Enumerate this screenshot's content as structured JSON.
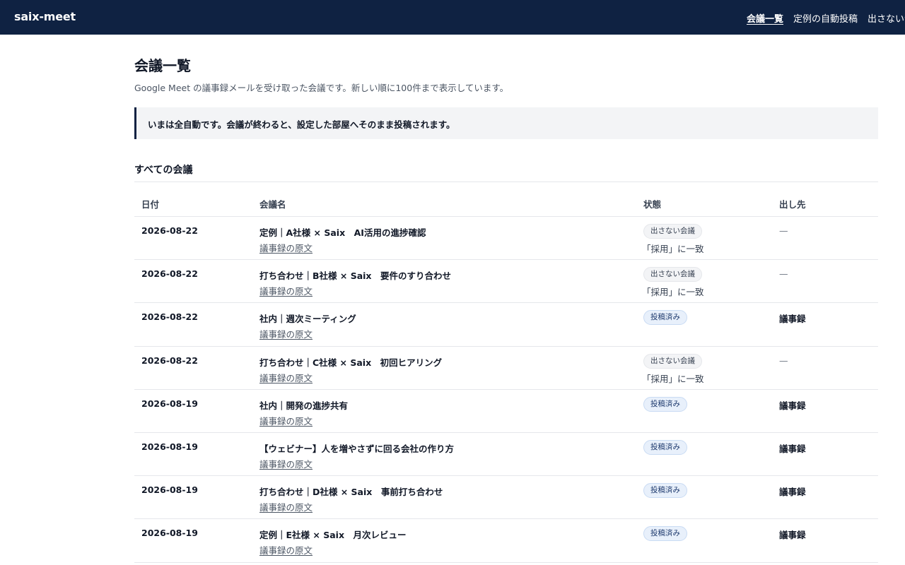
{
  "header": {
    "brand": "saix-meet",
    "nav": [
      {
        "label": "会議一覧",
        "active": true
      },
      {
        "label": "定例の自動投稿",
        "active": false
      },
      {
        "label": "出さない会議",
        "active": false
      }
    ]
  },
  "page": {
    "title": "会議一覧",
    "description": "Google Meet の議事録メールを受け取った会議です。新しい順に100件まで表示しています。",
    "notice": "いまは全自動です。会議が終わると、設定した部屋へそのまま投稿されます。",
    "section_title": "すべての会議"
  },
  "table": {
    "headers": {
      "date": "日付",
      "name": "会議名",
      "status": "状態",
      "destination": "出し先"
    },
    "rows": [
      {
        "date": "2026-08-22",
        "name": "定例｜A社様 × Saix　AI活用の進捗確認",
        "link": "議事録の原文",
        "status": "出さない会議",
        "status_type": "skip",
        "reason": "「採用」に一致",
        "destination": "—"
      },
      {
        "date": "2026-08-22",
        "name": "打ち合わせ｜B社様 × Saix　要件のすり合わせ",
        "link": "議事録の原文",
        "status": "出さない会議",
        "status_type": "skip",
        "reason": "「採用」に一致",
        "destination": "—"
      },
      {
        "date": "2026-08-22",
        "name": "社内｜週次ミーティング",
        "link": "議事録の原文",
        "status": "投稿済み",
        "status_type": "posted",
        "reason": "",
        "destination": "議事録"
      },
      {
        "date": "2026-08-22",
        "name": "打ち合わせ｜C社様 × Saix　初回ヒアリング",
        "link": "議事録の原文",
        "status": "出さない会議",
        "status_type": "skip",
        "reason": "「採用」に一致",
        "destination": "—"
      },
      {
        "date": "2026-08-19",
        "name": "社内｜開発の進捗共有",
        "link": "議事録の原文",
        "status": "投稿済み",
        "status_type": "posted",
        "reason": "",
        "destination": "議事録"
      },
      {
        "date": "2026-08-19",
        "name": "【ウェビナー】人を増やさずに回る会社の作り方",
        "link": "議事録の原文",
        "status": "投稿済み",
        "status_type": "posted",
        "reason": "",
        "destination": "議事録"
      },
      {
        "date": "2026-08-19",
        "name": "打ち合わせ｜D社様 × Saix　事前打ち合わせ",
        "link": "議事録の原文",
        "status": "投稿済み",
        "status_type": "posted",
        "reason": "",
        "destination": "議事録"
      },
      {
        "date": "2026-08-19",
        "name": "定例｜E社様 × Saix　月次レビュー",
        "link": "議事録の原文",
        "status": "投稿済み",
        "status_type": "posted",
        "reason": "",
        "destination": "議事録"
      }
    ]
  }
}
